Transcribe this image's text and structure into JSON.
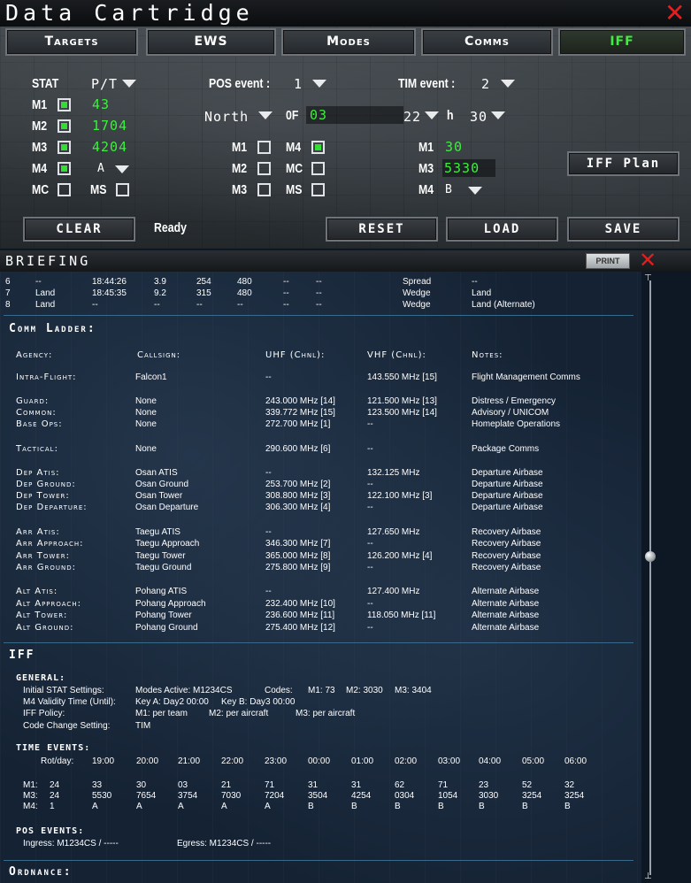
{
  "cartridge": {
    "title": "Data Cartridge",
    "tabs": [
      "Targets",
      "EWS",
      "Modes",
      "Comms",
      "IFF"
    ],
    "active_tab": "IFF",
    "stat_label": "STAT",
    "pt_label": "P/T",
    "m1_label": "M1",
    "m2_label": "M2",
    "m3_label": "M3",
    "m4_label": "M4",
    "mc_label": "MC",
    "ms_label": "MS",
    "m1_value": "43",
    "m2_value": "1704",
    "m3_value": "4204",
    "m4_value": "A",
    "pos_event_label": "POS event :",
    "pos_event_value": "1",
    "tim_event_label": "TIM event :",
    "tim_event_value": "2",
    "north_label": "North",
    "of_label": "0F",
    "of_value": "03",
    "hour_value": "22",
    "h_label": "h",
    "min_value": "30",
    "pos_m1_label": "M1",
    "pos_m2_label": "M2",
    "pos_m3_label": "M3",
    "pos_m4_label": "M4",
    "pos_mc_label": "MC",
    "pos_ms_label": "MS",
    "tim_m1_label": "M1",
    "tim_m1_value": "30",
    "tim_m3_label": "M3",
    "tim_m3_value": "5330",
    "tim_m4_label": "M4",
    "tim_m4_value": "B",
    "iff_plan_label": "IFF Plan",
    "clear_label": "CLEAR",
    "status": "Ready",
    "reset_label": "Reset",
    "load_label": "Load",
    "save_label": "Save"
  },
  "briefing": {
    "title": "BRIEFING",
    "print_label": "PRINT",
    "steerpoints": [
      [
        "6",
        "--",
        "18:44:26",
        "3.9",
        "254",
        "480",
        "--",
        "--",
        "Spread",
        "--"
      ],
      [
        "7",
        "Land",
        "18:45:35",
        "9.2",
        "315",
        "480",
        "--",
        "--",
        "Wedge",
        "Land"
      ],
      [
        "8",
        "Land",
        "--",
        "--",
        "--",
        "--",
        "--",
        "--",
        "Wedge",
        "Land (Alternate)"
      ]
    ],
    "comm_ladder_title": "Comm Ladder:",
    "comm_headers": [
      "Agency:",
      "Callsign:",
      "UHF (Chnl):",
      "VHF (Chnl):",
      "Notes:"
    ],
    "comm_rows": [
      [
        "Intra-Flight:",
        "Falcon1",
        "--",
        "143.550 MHz [15]",
        "Flight Management Comms"
      ],
      [
        "Guard:",
        "None",
        "243.000 MHz [14]",
        "121.500 MHz [13]",
        "Distress / Emergency"
      ],
      [
        "Common:",
        "None",
        "339.772 MHz [15]",
        "123.500 MHz [14]",
        "Advisory / UNICOM"
      ],
      [
        "Base Ops:",
        "None",
        "272.700 MHz [1]",
        "--",
        "Homeplate Operations"
      ],
      [
        "Tactical:",
        "None",
        "290.600 MHz [6]",
        "--",
        "Package Comms"
      ],
      [
        "Dep Atis:",
        "Osan ATIS",
        "--",
        "132.125 MHz",
        "Departure Airbase"
      ],
      [
        "Dep Ground:",
        "Osan Ground",
        "253.700 MHz [2]",
        "--",
        "Departure Airbase"
      ],
      [
        "Dep Tower:",
        "Osan Tower",
        "308.800 MHz [3]",
        "122.100 MHz [3]",
        "Departure Airbase"
      ],
      [
        "Dep Departure:",
        "Osan Departure",
        "306.300 MHz [4]",
        "--",
        "Departure Airbase"
      ],
      [
        "Arr Atis:",
        "Taegu ATIS",
        "--",
        "127.650 MHz",
        "Recovery Airbase"
      ],
      [
        "Arr Approach:",
        "Taegu Approach",
        "346.300 MHz [7]",
        "--",
        "Recovery Airbase"
      ],
      [
        "Arr Tower:",
        "Taegu Tower",
        "365.000 MHz [8]",
        "126.200 MHz [4]",
        "Recovery Airbase"
      ],
      [
        "Arr Ground:",
        "Taegu Ground",
        "275.800 MHz [9]",
        "--",
        "Recovery Airbase"
      ],
      [
        "Alt Atis:",
        "Pohang ATIS",
        "--",
        "127.400 MHz",
        "Alternate Airbase"
      ],
      [
        "Alt Approach:",
        "Pohang Approach",
        "232.400 MHz [10]",
        "--",
        "Alternate Airbase"
      ],
      [
        "Alt Tower:",
        "Pohang Tower",
        "236.600 MHz [11]",
        "118.050 MHz [11]",
        "Alternate Airbase"
      ],
      [
        "Alt Ground:",
        "Pohang Ground",
        "275.400 MHz [12]",
        "--",
        "Alternate Airbase"
      ]
    ],
    "iff_title": "IFF",
    "general_title": "GENERAL:",
    "general": {
      "initial_stat_label": "Initial STAT Settings:",
      "modes_active": "Modes Active: M1234CS",
      "codes_label": "Codes:",
      "code_m1": "M1: 73",
      "code_m2": "M2: 3030",
      "code_m3": "M3: 3404",
      "m4_validity_label": "M4 Validity Time (Until):",
      "key_a": "Key A: Day2 00:00",
      "key_b": "Key B: Day3 00:00",
      "iff_policy_label": "IFF Policy:",
      "policy_m1": "M1: per team",
      "policy_m2": "M2: per aircraft",
      "policy_m3": "M3: per aircraft",
      "code_change_label": "Code Change Setting:",
      "code_change_value": "TIM"
    },
    "time_events_title": "TIME EVENTS:",
    "time_events_header_label": "Rot/day:",
    "time_events_hours": [
      "19:00",
      "20:00",
      "21:00",
      "22:00",
      "23:00",
      "00:00",
      "01:00",
      "02:00",
      "03:00",
      "04:00",
      "05:00",
      "06:00"
    ],
    "time_events_rows": [
      {
        "label": "M1:",
        "first": "24",
        "values": [
          "33",
          "30",
          "03",
          "21",
          "71",
          "31",
          "31",
          "62",
          "71",
          "23",
          "52",
          "32"
        ]
      },
      {
        "label": "M3:",
        "first": "24",
        "values": [
          "5530",
          "7654",
          "3754",
          "7030",
          "7204",
          "3504",
          "4254",
          "0304",
          "1054",
          "3030",
          "3254",
          "3254"
        ]
      },
      {
        "label": "M4:",
        "first": "1",
        "values": [
          "A",
          "A",
          "A",
          "A",
          "A",
          "B",
          "B",
          "B",
          "B",
          "B",
          "B",
          "B"
        ]
      }
    ],
    "pos_events_title": "POS EVENTS:",
    "ingress": "Ingress: M1234CS / -----",
    "egress": "Egress: M1234CS / -----",
    "ordnance_title": "Ordnance:"
  }
}
